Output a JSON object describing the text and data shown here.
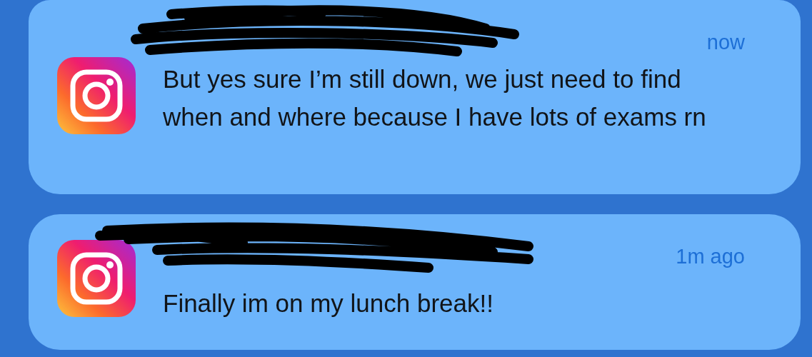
{
  "notifications": [
    {
      "time": "now",
      "message": "But yes sure I’m still down, we just need to find when and where because I have lots of exams rn",
      "sender_redacted": true
    },
    {
      "time": "1m ago",
      "message": "Finally im on my lunch break!!",
      "sender_redacted": true
    }
  ]
}
